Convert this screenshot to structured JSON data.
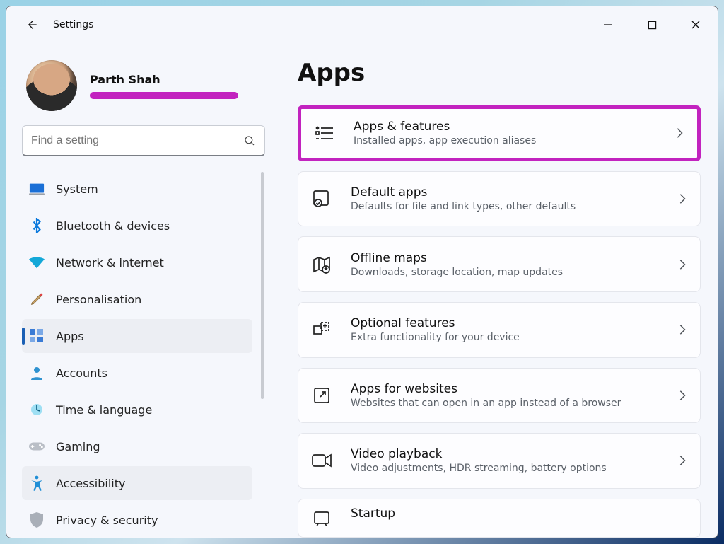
{
  "window": {
    "title": "Settings"
  },
  "profile": {
    "name": "Parth Shah"
  },
  "search": {
    "placeholder": "Find a setting"
  },
  "sidebar": {
    "items": [
      {
        "label": "System"
      },
      {
        "label": "Bluetooth & devices"
      },
      {
        "label": "Network & internet"
      },
      {
        "label": "Personalisation"
      },
      {
        "label": "Apps"
      },
      {
        "label": "Accounts"
      },
      {
        "label": "Time & language"
      },
      {
        "label": "Gaming"
      },
      {
        "label": "Accessibility"
      },
      {
        "label": "Privacy & security"
      }
    ]
  },
  "main": {
    "heading": "Apps",
    "cards": [
      {
        "title": "Apps & features",
        "subtitle": "Installed apps, app execution aliases"
      },
      {
        "title": "Default apps",
        "subtitle": "Defaults for file and link types, other defaults"
      },
      {
        "title": "Offline maps",
        "subtitle": "Downloads, storage location, map updates"
      },
      {
        "title": "Optional features",
        "subtitle": "Extra functionality for your device"
      },
      {
        "title": "Apps for websites",
        "subtitle": "Websites that can open in an app instead of a browser"
      },
      {
        "title": "Video playback",
        "subtitle": "Video adjustments, HDR streaming, battery options"
      },
      {
        "title": "Startup",
        "subtitle": ""
      }
    ]
  }
}
